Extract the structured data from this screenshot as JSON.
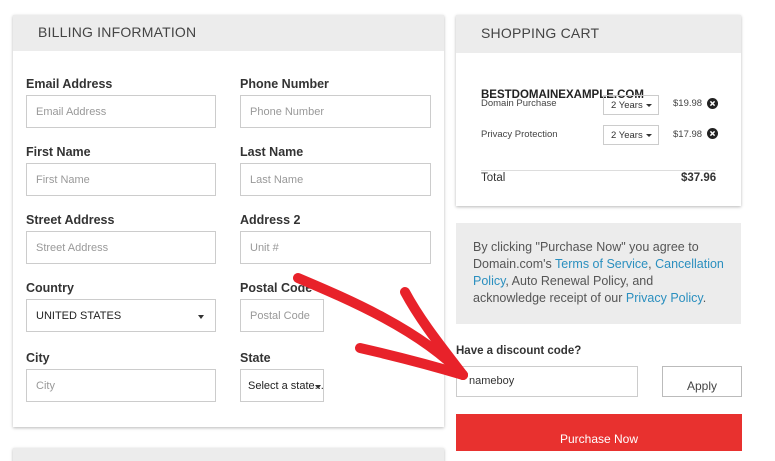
{
  "billing": {
    "title": "BILLING INFORMATION",
    "email": {
      "label": "Email Address",
      "placeholder": "Email Address"
    },
    "phone": {
      "label": "Phone Number",
      "placeholder": "Phone Number"
    },
    "first_name": {
      "label": "First Name",
      "placeholder": "First Name"
    },
    "last_name": {
      "label": "Last Name",
      "placeholder": "Last Name"
    },
    "street": {
      "label": "Street Address",
      "placeholder": "Street Address"
    },
    "address2": {
      "label": "Address 2",
      "placeholder": "Unit #"
    },
    "country": {
      "label": "Country",
      "value": "UNITED STATES"
    },
    "postal": {
      "label": "Postal Code",
      "placeholder": "Postal Code"
    },
    "city": {
      "label": "City",
      "placeholder": "City"
    },
    "state": {
      "label": "State",
      "value": "Select a state..."
    }
  },
  "cart": {
    "title": "SHOPPING CART",
    "domain": "BESTDOMAINEXAMPLE.COM",
    "items": [
      {
        "name": "Domain Purchase",
        "term": "2 Years",
        "price": "$19.98"
      },
      {
        "name": "Privacy Protection",
        "term": "2 Years",
        "price": "$17.98"
      }
    ],
    "total_label": "Total",
    "total_value": "$37.96"
  },
  "terms": {
    "text_1": "By clicking \"Purchase Now\" you agree to Domain.com's ",
    "link_tos": "Terms of Service",
    "text_2": ", ",
    "link_cancel": "Cancellation Policy",
    "text_3": ", Auto Renewal Policy, and acknowledge receipt of our ",
    "link_privacy": "Privacy Policy",
    "text_4": "."
  },
  "discount": {
    "label": "Have a discount code?",
    "value": "nameboy",
    "apply_label": "Apply"
  },
  "purchase_label": "Purchase Now",
  "colors": {
    "accent_red": "#e8312f",
    "link_blue": "#2a8fbf",
    "annotation_arrow": "#e8222a"
  }
}
